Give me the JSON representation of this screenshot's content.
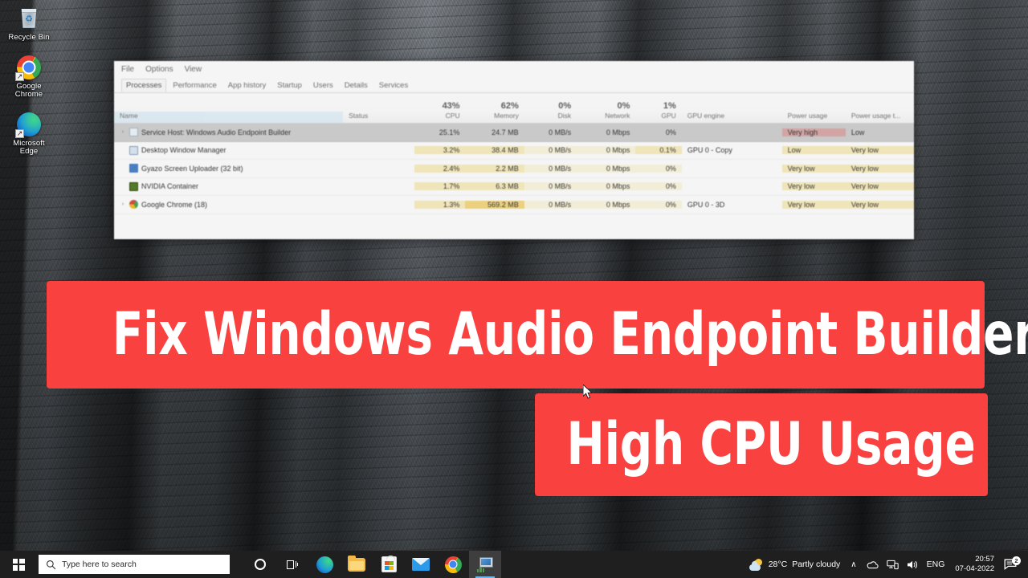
{
  "theme": {
    "accent_red": "#f9413f",
    "taskbar_bg": "#1f1f1f",
    "selected_row": "#cfcfcf"
  },
  "desktop": {
    "icons": [
      {
        "name": "recycle-bin",
        "label": "Recycle Bin"
      },
      {
        "name": "google-chrome",
        "label": "Google\nChrome"
      },
      {
        "name": "microsoft-edge",
        "label": "Microsoft\nEdge"
      }
    ],
    "icon_labels": {
      "recycle_bin": "Recycle Bin",
      "chrome_l1": "Google",
      "chrome_l2": "Chrome",
      "edge_l1": "Microsoft",
      "edge_l2": "Edge"
    }
  },
  "overlay": {
    "banner1": "Fix Windows Audio Endpoint Builder",
    "banner2": "High CPU Usage"
  },
  "task_manager": {
    "menu": {
      "file": "File",
      "options": "Options",
      "view": "View"
    },
    "tabs": [
      {
        "label": "Processes",
        "active": true
      },
      {
        "label": "Performance",
        "active": false
      },
      {
        "label": "App history",
        "active": false
      },
      {
        "label": "Startup",
        "active": false
      },
      {
        "label": "Users",
        "active": false
      },
      {
        "label": "Details",
        "active": false
      },
      {
        "label": "Services",
        "active": false
      }
    ],
    "columns": {
      "name": {
        "title": "Name",
        "pct": ""
      },
      "status": {
        "title": "Status",
        "pct": ""
      },
      "cpu": {
        "title": "CPU",
        "pct": "43%"
      },
      "memory": {
        "title": "Memory",
        "pct": "62%"
      },
      "disk": {
        "title": "Disk",
        "pct": "0%"
      },
      "network": {
        "title": "Network",
        "pct": "0%"
      },
      "gpu": {
        "title": "GPU",
        "pct": "1%"
      },
      "gpu_engine": {
        "title": "GPU engine",
        "pct": ""
      },
      "power": {
        "title": "Power usage",
        "pct": ""
      },
      "power_trend": {
        "title": "Power usage t...",
        "pct": ""
      }
    },
    "sort_caret": "▲",
    "rows": [
      {
        "name": "Service Host: Windows Audio Endpoint Builder",
        "icon": "service-host-icon",
        "expandable": true,
        "status": "",
        "cpu": "25.1%",
        "memory": "24.7 MB",
        "disk": "0 MB/s",
        "network": "0 Mbps",
        "gpu": "0%",
        "gpu_engine": "",
        "power": "Very high",
        "power_trend": "Low",
        "selected": true
      },
      {
        "name": "Desktop Window Manager",
        "icon": "desktop-window-manager-icon",
        "expandable": false,
        "status": "",
        "cpu": "3.2%",
        "memory": "38.4 MB",
        "disk": "0 MB/s",
        "network": "0 Mbps",
        "gpu": "0.1%",
        "gpu_engine": "GPU 0 - Copy",
        "power": "Low",
        "power_trend": "Very low",
        "selected": false
      },
      {
        "name": "Gyazo Screen Uploader (32 bit)",
        "icon": "gyazo-icon",
        "expandable": false,
        "status": "",
        "cpu": "2.4%",
        "memory": "2.2 MB",
        "disk": "0 MB/s",
        "network": "0 Mbps",
        "gpu": "0%",
        "gpu_engine": "",
        "power": "Very low",
        "power_trend": "Very low",
        "selected": false
      },
      {
        "name": "NVIDIA Container",
        "icon": "nvidia-icon",
        "expandable": false,
        "status": "",
        "cpu": "1.7%",
        "memory": "6.3 MB",
        "disk": "0 MB/s",
        "network": "0 Mbps",
        "gpu": "0%",
        "gpu_engine": "",
        "power": "Very low",
        "power_trend": "Very low",
        "selected": false
      },
      {
        "name": "Google Chrome (18)",
        "icon": "chrome-icon",
        "expandable": true,
        "status": "",
        "cpu": "1.3%",
        "memory": "569.2 MB",
        "disk": "0 MB/s",
        "network": "0 Mbps",
        "gpu": "0%",
        "gpu_engine": "GPU 0 - 3D",
        "power": "Very low",
        "power_trend": "Very low",
        "selected": false
      }
    ]
  },
  "taskbar": {
    "search_placeholder": "Type here to search",
    "buttons": [
      {
        "name": "cortana-button",
        "label": "Cortana"
      },
      {
        "name": "task-view-button",
        "label": "Task View"
      },
      {
        "name": "edge-button",
        "label": "Microsoft Edge"
      },
      {
        "name": "file-explorer-button",
        "label": "File Explorer"
      },
      {
        "name": "microsoft-store-button",
        "label": "Microsoft Store"
      },
      {
        "name": "mail-button",
        "label": "Mail"
      },
      {
        "name": "chrome-button",
        "label": "Google Chrome"
      },
      {
        "name": "task-manager-button",
        "label": "Task Manager"
      }
    ],
    "tray": {
      "temperature": "28°C",
      "weather": "Partly cloudy",
      "chevron": "∧",
      "language": "ENG",
      "time": "20:57",
      "date": "07-04-2022",
      "notification_count": "2"
    }
  }
}
